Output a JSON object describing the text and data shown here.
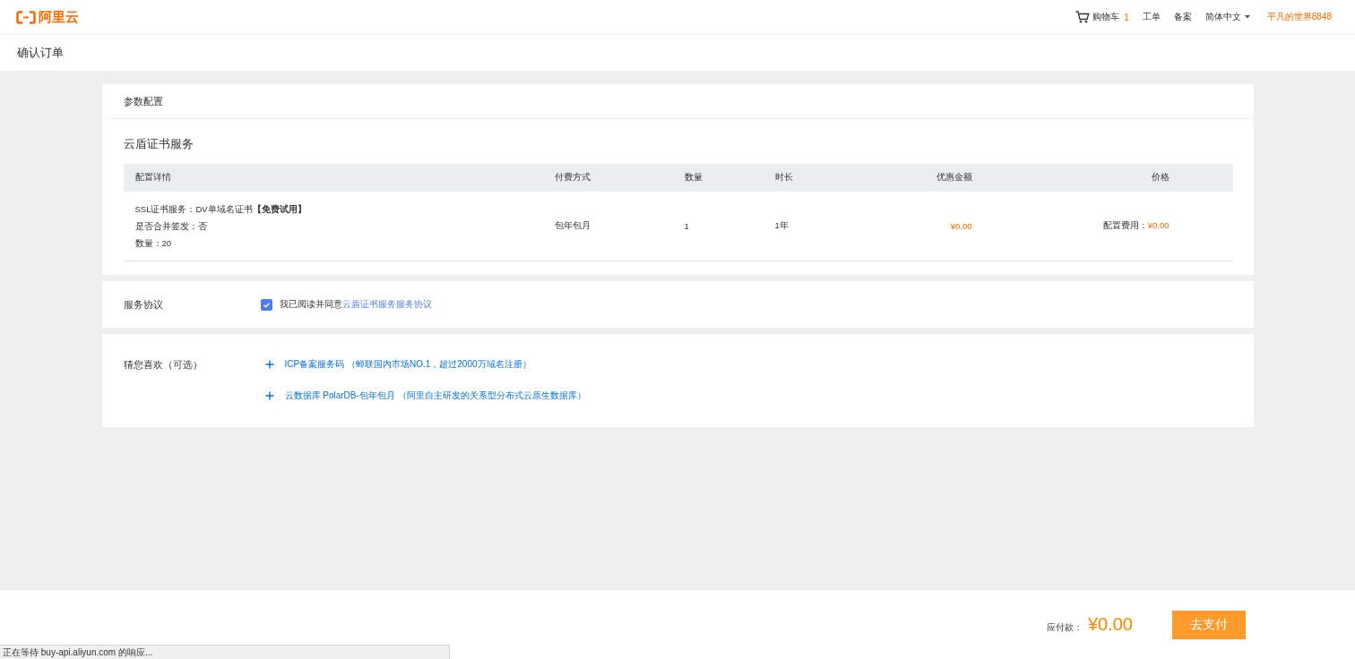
{
  "header": {
    "logo": "阿里云",
    "nav": [
      {
        "kind": "cart",
        "label": "购物车",
        "count": "1"
      },
      {
        "kind": "link",
        "label": "工单"
      },
      {
        "kind": "link",
        "label": "备案"
      },
      {
        "kind": "dropdown",
        "label": "简体中文"
      },
      {
        "kind": "user",
        "label": "平凡的世界8848"
      }
    ]
  },
  "page_title": "确认订单",
  "config_card": {
    "title": "参数配置",
    "product": "云盾证书服务",
    "table": {
      "columns": [
        "配置详情",
        "付费方式",
        "数量",
        "时长",
        "优惠金额",
        "价格"
      ],
      "rows": [
        {
          "details": [
            "SSL证书服务：DV单域名证书**【免费试用】**",
            "是否合并签发：否",
            "数量：20"
          ],
          "payment": "包年包月",
          "quantity": "1",
          "duration": "1年",
          "discount": "¥0.00",
          "price_label": "配置费用：",
          "price": "¥0.00"
        }
      ]
    }
  },
  "agreement": {
    "label": "服务协议",
    "checked": true,
    "text": "我已阅读并同意",
    "link": "云盾证书服务服务协议"
  },
  "recommendations": {
    "label": "猜您喜欢（可选）",
    "items": [
      {
        "label": "ICP备案服务码 （蝉联国内市场NO.1，超过2000万域名注册）"
      },
      {
        "label": "云数据库 PolarDB-包年包月 （阿里自主研发的关系型分布式云原生数据库）"
      }
    ]
  },
  "footer": {
    "total_label": "应付款：",
    "total": "¥0.00",
    "button": "去支付"
  },
  "status_bar": "正在等待 buy-api.aliyun.com 的响应..."
}
